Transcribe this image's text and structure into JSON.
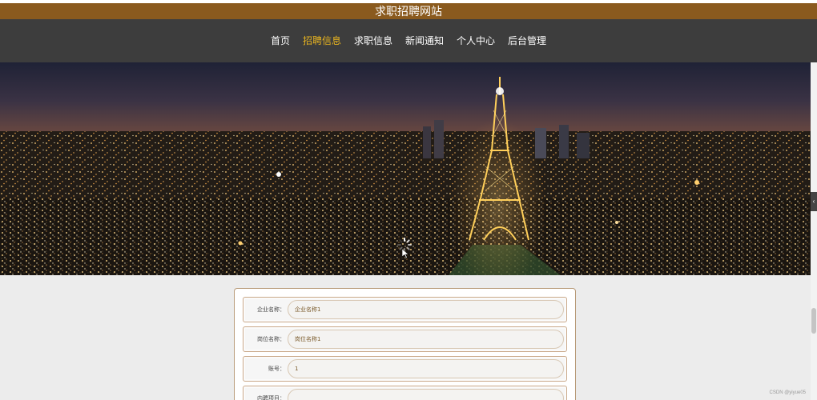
{
  "header": {
    "site_title": "求职招聘网站"
  },
  "nav": {
    "items": [
      {
        "label": "首页",
        "active": false
      },
      {
        "label": "招聘信息",
        "active": true
      },
      {
        "label": "求职信息",
        "active": false
      },
      {
        "label": "新闻通知",
        "active": false
      },
      {
        "label": "个人中心",
        "active": false
      },
      {
        "label": "后台管理",
        "active": false
      }
    ]
  },
  "banner": {
    "image": "eiffel-tower-night-city"
  },
  "form": {
    "fields": [
      {
        "label": "企业名称：",
        "value": "企业名称1"
      },
      {
        "label": "岗位名称：",
        "value": "岗位名称1"
      },
      {
        "label": "账号：",
        "value": "1"
      },
      {
        "label": "内聘项目：",
        "value": ""
      }
    ]
  },
  "watermark": "CSDN @yiyue05",
  "colors": {
    "title_bar": "#8a5a1e",
    "nav_bg": "#3d3d3d",
    "nav_active": "#e8b420",
    "content_bg": "#ececec"
  }
}
